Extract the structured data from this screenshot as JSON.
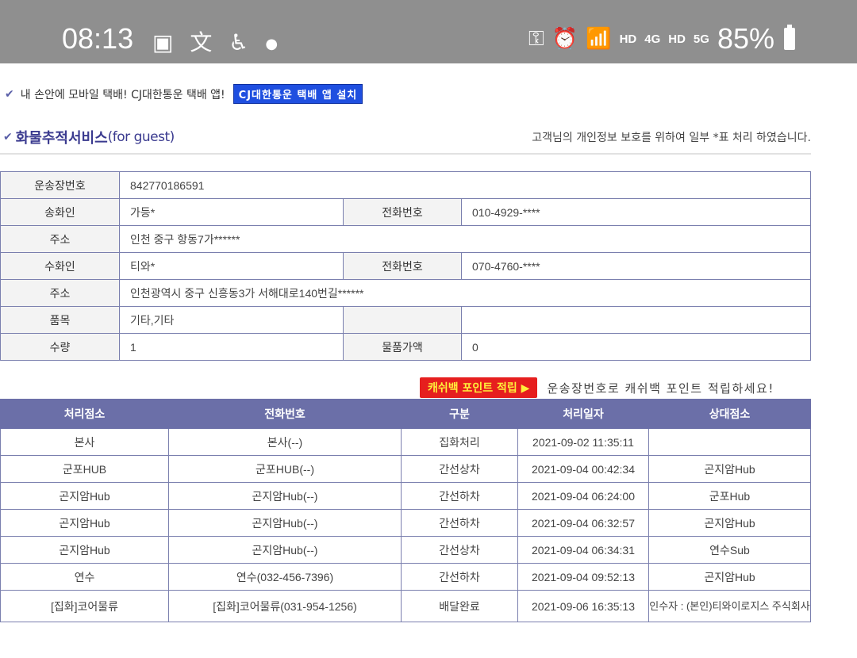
{
  "status_bar": {
    "time": "08:13",
    "left_icons": [
      "image-icon",
      "translate-icon",
      "accessibility-icon",
      "dot-icon"
    ],
    "right_icons": [
      "key-icon",
      "alarm-icon",
      "wifi-icon"
    ],
    "hd1": "HD",
    "net1": "4G",
    "hd2": "HD",
    "net2": "5G",
    "battery": "85%"
  },
  "promo": {
    "text": "내 손안에 모바일 택배! CJ대한통운 택배 앱!",
    "button": "CJ대한통운 택배 앱 설치"
  },
  "section": {
    "title_ko": "화물추적서비스",
    "title_en": "(for guest)",
    "privacy_note": "고객님의 개인정보 보호를 위하여 일부 *표 처리 하였습니다."
  },
  "info": {
    "waybill_label": "운송장번호",
    "waybill": "842770186591",
    "sender_label": "송화인",
    "sender": "가등*",
    "sender_phone_label": "전화번호",
    "sender_phone": "010-4929-****",
    "sender_addr_label": "주소",
    "sender_addr": "인천 중구 항동7가******",
    "receiver_label": "수화인",
    "receiver": "티와*",
    "receiver_phone_label": "전화번호",
    "receiver_phone": "070-4760-****",
    "receiver_addr_label": "주소",
    "receiver_addr": "인천광역시 중구 신흥동3가 서해대로140번길******",
    "item_label": "품목",
    "item": "기타,기타",
    "qty_label": "수량",
    "qty": "1",
    "price_label": "물품가액",
    "price": "0"
  },
  "cashback": {
    "button": "캐쉬백 포인트 적립 ▶",
    "text": "운송장번호로 캐쉬백 포인트 적립하세요!"
  },
  "tracking": {
    "headers": [
      "처리점소",
      "전화번호",
      "구분",
      "처리일자",
      "상대점소"
    ],
    "rows": [
      [
        "본사",
        "본사(--)",
        "집화처리",
        "2021-09-02 11:35:11",
        ""
      ],
      [
        "군포HUB",
        "군포HUB(--)",
        "간선상차",
        "2021-09-04 00:42:34",
        "곤지암Hub"
      ],
      [
        "곤지암Hub",
        "곤지암Hub(--)",
        "간선하차",
        "2021-09-04 06:24:00",
        "군포Hub"
      ],
      [
        "곤지암Hub",
        "곤지암Hub(--)",
        "간선하차",
        "2021-09-04 06:32:57",
        "곤지암Hub"
      ],
      [
        "곤지암Hub",
        "곤지암Hub(--)",
        "간선상차",
        "2021-09-04 06:34:31",
        "연수Sub"
      ],
      [
        "연수",
        "연수(032-456-7396)",
        "간선하차",
        "2021-09-04 09:52:13",
        "곤지암Hub"
      ],
      [
        "[집화]코어물류",
        "[집화]코어물류(031-954-1256)",
        "배달완료",
        "2021-09-06 16:35:13",
        "인수자 : (본인)티와이로지스 주식회사"
      ]
    ]
  }
}
